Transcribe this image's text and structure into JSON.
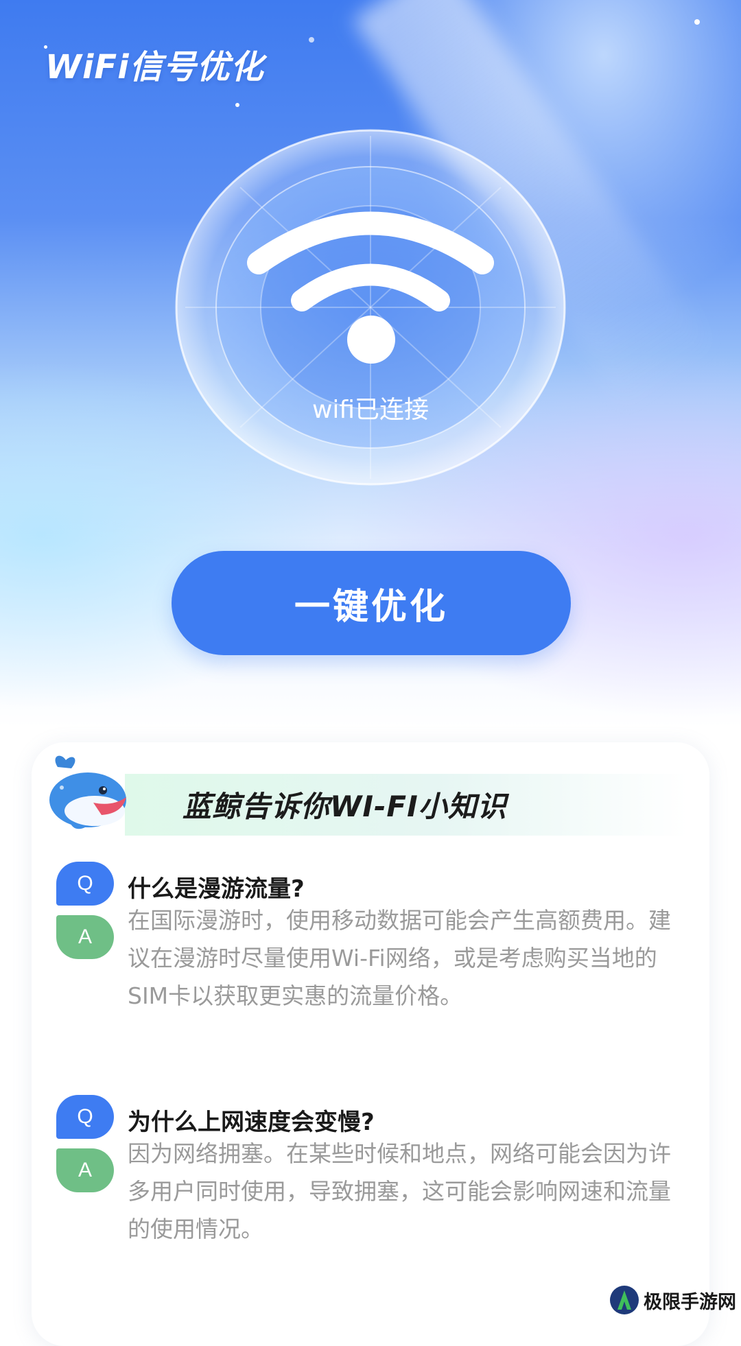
{
  "app_title": "WiFi信号优化",
  "status": {
    "connection_label": "wifi已连接"
  },
  "primary_action": {
    "label": "一键优化"
  },
  "knowledge_card": {
    "title": "蓝鲸告诉你WI-FI小知识",
    "items": [
      {
        "q_badge": "Q",
        "question": "什么是漫游流量?",
        "a_badge": "A",
        "answer": "在国际漫游时，使用移动数据可能会产生高额费用。建议在漫游时尽量使用Wi-Fi网络，或是考虑购买当地的SIM卡以获取更实惠的流量价格。"
      },
      {
        "q_badge": "Q",
        "question": "为什么上网速度会变慢?",
        "a_badge": "A",
        "answer": "因为网络拥塞。在某些时候和地点，网络可能会因为许多用户同时使用，导致拥塞，这可能会影响网速和流量的使用情况。"
      }
    ]
  },
  "watermark": {
    "text": "极限手游网"
  },
  "colors": {
    "accent_blue": "#3e7cf2",
    "answer_green": "#6fbf86",
    "answer_text_gray": "#9a9a9a"
  }
}
